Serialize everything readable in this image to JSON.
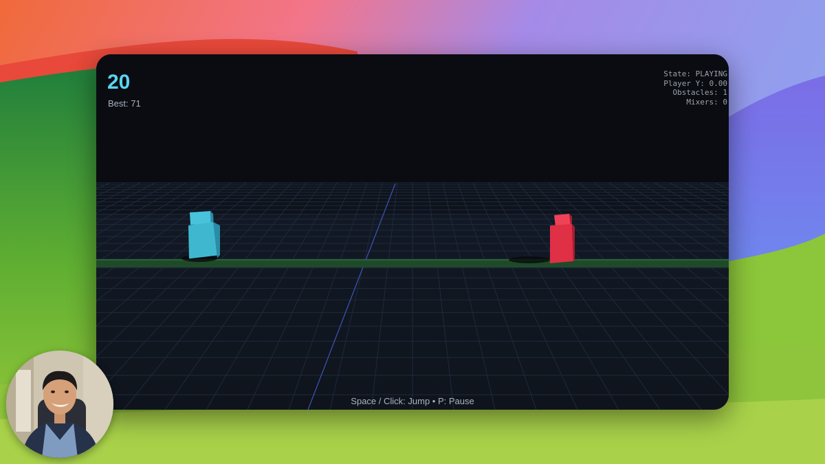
{
  "game": {
    "score": "20",
    "best": "Best: 71",
    "debug": {
      "state": "State: PLAYING",
      "player_y": "Player Y: 0.00",
      "obstacles": "Obstacles: 1",
      "mixers": "Mixers: 0"
    },
    "controls_hint": "Space / Click: Jump • P: Pause"
  },
  "colors": {
    "player": "#3fb8cf",
    "obstacle": "#e03046",
    "score": "#59d4ee",
    "grid": "#1f2a3d",
    "track": "#1f4a2a"
  },
  "icons": {
    "player": "player-cube-icon",
    "obstacle": "obstacle-block-icon"
  }
}
